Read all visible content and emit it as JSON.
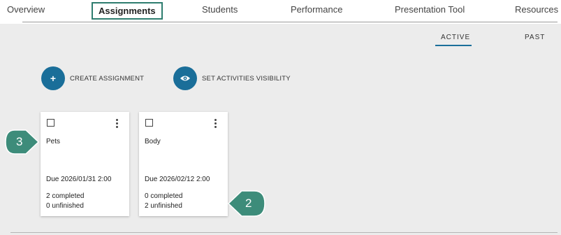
{
  "nav": {
    "tabs": [
      {
        "label": "Overview"
      },
      {
        "label": "Assignments"
      },
      {
        "label": "Students"
      },
      {
        "label": "Performance"
      },
      {
        "label": "Presentation Tool"
      },
      {
        "label": "Resources"
      }
    ],
    "active_tab": "Assignments"
  },
  "subtabs": [
    {
      "label": "ACTIVE",
      "active": true
    },
    {
      "label": "PAST",
      "active": false
    }
  ],
  "actions": {
    "create": {
      "icon": "plus-icon",
      "glyph": "+",
      "label": "CREATE ASSIGNMENT"
    },
    "visibility": {
      "icon": "eye-icon",
      "label": "SET ACTIVITIES VISIBILITY"
    }
  },
  "cards": [
    {
      "title": "Pets",
      "due": "Due 2026/01/31 2:00",
      "completed": "2 completed",
      "unfinished": "0 unfinished"
    },
    {
      "title": "Body",
      "due": "Due 2026/02/12 2:00",
      "completed": "0 completed",
      "unfinished": "2 unfinished"
    }
  ],
  "callouts": [
    {
      "number": "3"
    },
    {
      "number": "2"
    }
  ],
  "colors": {
    "accent_blue": "#1a6e99",
    "callout_green": "#3d8c7a",
    "active_tab_border": "#2e7d6f",
    "page_bg": "#ececec"
  }
}
